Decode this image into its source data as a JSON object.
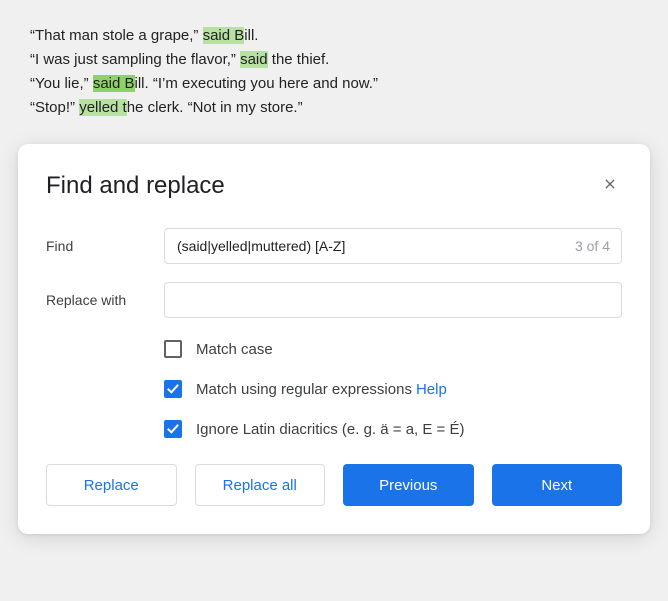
{
  "document": {
    "lines": [
      {
        "pre": "“That man stole a grape,” ",
        "hl": "said B",
        "hl_class": "hl",
        "post": "ill."
      },
      {
        "pre": "“I was just sampling the flavor,” ",
        "hl": "said",
        "hl_class": "hl",
        "post": " the thief."
      },
      {
        "pre": "“You lie,” ",
        "hl": "said B",
        "hl_class": "hl-current",
        "post": "ill. “I’m executing you here and now.”"
      },
      {
        "pre": "“Stop!” ",
        "hl": "yelled t",
        "hl_class": "hl",
        "post": "he clerk. “Not in my store.”"
      }
    ]
  },
  "dialog": {
    "title": "Find and replace",
    "find_label": "Find",
    "find_value": "(said|yelled|muttered) [A-Z]",
    "match_count": "3 of 4",
    "replace_label": "Replace with",
    "replace_value": "",
    "options": {
      "match_case": {
        "label": "Match case",
        "checked": false
      },
      "regex": {
        "label": "Match using regular expressions",
        "checked": true,
        "help": "Help"
      },
      "diacritics": {
        "label": "Ignore Latin diacritics (e. g. ä = a, E = É)",
        "checked": true
      }
    },
    "buttons": {
      "replace": "Replace",
      "replace_all": "Replace all",
      "previous": "Previous",
      "next": "Next"
    }
  }
}
